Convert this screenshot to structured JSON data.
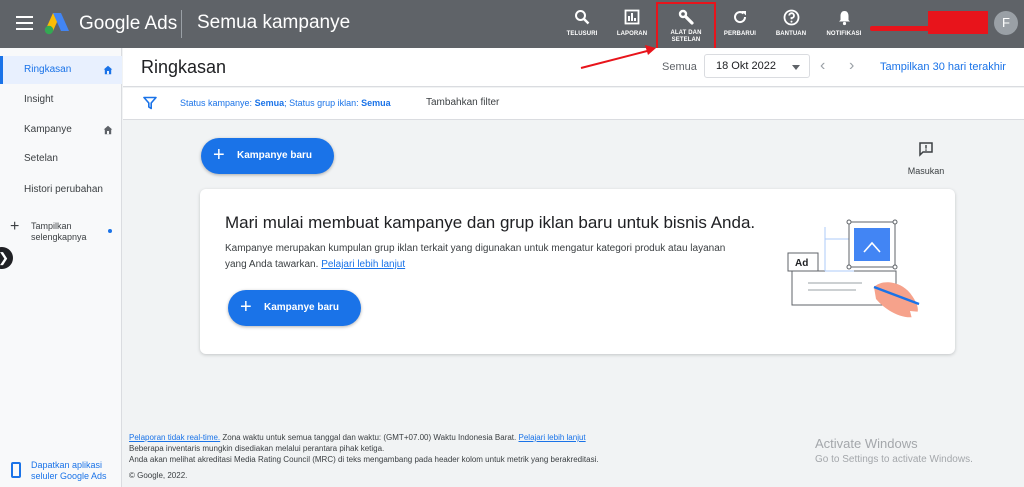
{
  "topbar": {
    "brand": "Google Ads",
    "page_heading": "Semua kampanye",
    "tools": [
      {
        "label": "TELUSURI",
        "icon": "search-icon"
      },
      {
        "label": "LAPORAN",
        "icon": "reports-icon"
      },
      {
        "label": "ALAT DAN SETELAN",
        "icon": "wrench-icon"
      },
      {
        "label": "PERBARUI",
        "icon": "refresh-icon"
      },
      {
        "label": "BANTUAN",
        "icon": "help-icon"
      },
      {
        "label": "NOTIFIKASI",
        "icon": "bell-icon"
      }
    ],
    "avatar_initial": "F"
  },
  "sidebar": {
    "items": [
      {
        "label": "Ringkasan"
      },
      {
        "label": "Insight"
      },
      {
        "label": "Kampanye"
      },
      {
        "label": "Setelan"
      },
      {
        "label": "Histori perubahan"
      }
    ],
    "more_label_1": "Tampilkan",
    "more_label_2": "selengkapnya",
    "app_promo_1": "Dapatkan aplikasi",
    "app_promo_2": "seluler Google Ads"
  },
  "header": {
    "title": "Ringkasan",
    "range_prefix": "Semua",
    "date_value": "18 Okt 2022",
    "range_link": "Tampilkan 30 hari terakhir"
  },
  "filter": {
    "campaign_status_label": "Status kampanye:",
    "campaign_status_value": "Semua",
    "adgroup_status_label": "; Status grup iklan:",
    "adgroup_status_value": "Semua",
    "add_filter": "Tambahkan filter"
  },
  "main": {
    "new_campaign_button": "Kampanye baru",
    "feedback_label": "Masukan",
    "card_heading": "Mari mulai membuat kampanye dan grup iklan baru untuk bisnis Anda.",
    "card_desc": "Kampanye merupakan kumpulan grup iklan terkait yang digunakan untuk mengatur kategori produk atau layanan yang Anda tawarkan.",
    "card_link": "Pelajari lebih lanjut",
    "card_button": "Kampanye baru",
    "ad_label": "Ad"
  },
  "footer": {
    "realtime_link": "Pelaporan tidak real-time.",
    "timezone_text": "Zona waktu untuk semua tanggal dan waktu: (GMT+07.00) Waktu Indonesia Barat.",
    "learn_more": "Pelajari lebih lanjut",
    "line2": "Beberapa inventaris mungkin disediakan melalui perantara pihak ketiga.",
    "line3": "Anda akan melihat akreditasi Media Rating Council (MRC) di teks mengambang pada header kolom untuk metrik yang berakreditasi.",
    "copyright": "© Google, 2022."
  },
  "watermark": {
    "title": "Activate Windows",
    "subtitle": "Go to Settings to activate Windows."
  },
  "colors": {
    "topbar": "#5f6368",
    "accent": "#1a73e8",
    "highlight": "#e8141b"
  }
}
